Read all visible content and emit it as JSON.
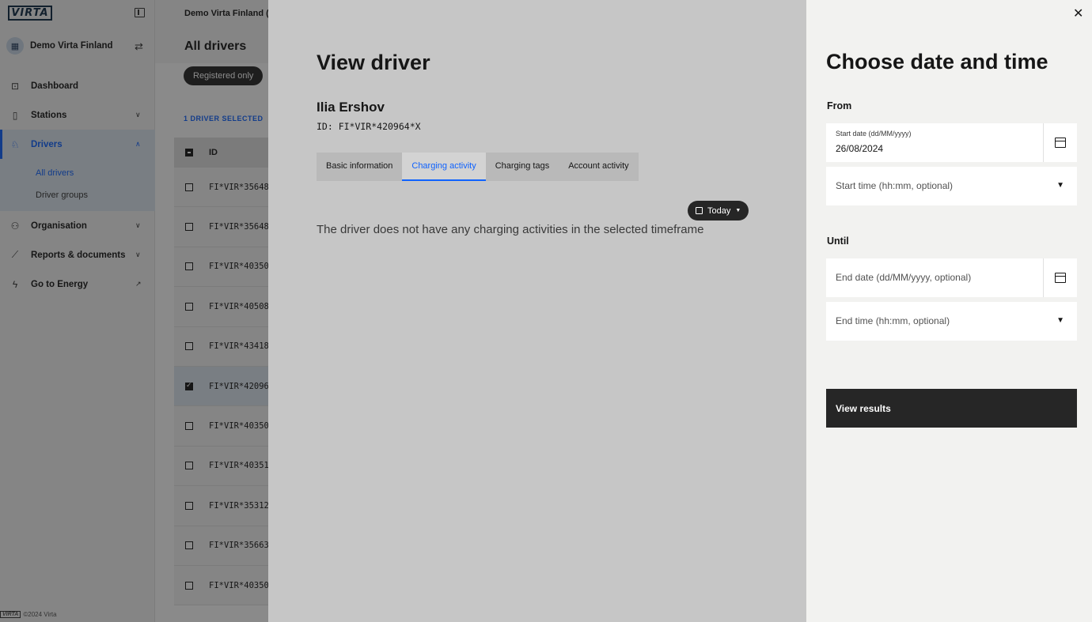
{
  "app": {
    "logo": "VIRTA"
  },
  "sidebar": {
    "org_name": "Demo Virta Finland",
    "items": [
      {
        "label": "Dashboard",
        "icon": "dashboard-icon"
      },
      {
        "label": "Stations",
        "icon": "charger-icon"
      },
      {
        "label": "Drivers",
        "icon": "driver-icon",
        "sub": [
          "All drivers",
          "Driver groups"
        ]
      },
      {
        "label": "Organisation",
        "icon": "organisation-icon"
      },
      {
        "label": "Reports & documents",
        "icon": "chart-line-icon"
      },
      {
        "label": "Go to Energy",
        "icon": "bolt-icon"
      }
    ],
    "footer": "©2024 Virta"
  },
  "main": {
    "breadcrumb": "Demo Virta Finland (F",
    "title": "All drivers",
    "filter_chip": "Registered only",
    "selected_count": "1 DRIVER SELECTED",
    "table": {
      "header_id": "ID",
      "rows": [
        "FI*VIR*35648",
        "FI*VIR*35648",
        "FI*VIR*40350",
        "FI*VIR*40508",
        "FI*VIR*43418",
        "FI*VIR*42096",
        "FI*VIR*40350",
        "FI*VIR*40351",
        "FI*VIR*35312",
        "FI*VIR*35663",
        "FI*VIR*40350"
      ]
    }
  },
  "driver_panel": {
    "title": "View driver",
    "name": "Ilia Ershov",
    "id_text": "ID: FI*VIR*420964*X",
    "tabs": [
      "Basic information",
      "Charging activity",
      "Charging tags",
      "Account activity"
    ],
    "today_label": "Today",
    "empty_message": "The driver does not have any charging activities in the selected timeframe"
  },
  "drawer": {
    "title": "Choose date and time",
    "from_label": "From",
    "start_date_label": "Start date (dd/MM/yyyy)",
    "start_date_value": "26/08/2024",
    "start_time_placeholder": "Start time (hh:mm, optional)",
    "until_label": "Until",
    "end_date_placeholder": "End date (dd/MM/yyyy, optional)",
    "end_time_placeholder": "End time (hh:mm, optional)",
    "view_results": "View results"
  }
}
